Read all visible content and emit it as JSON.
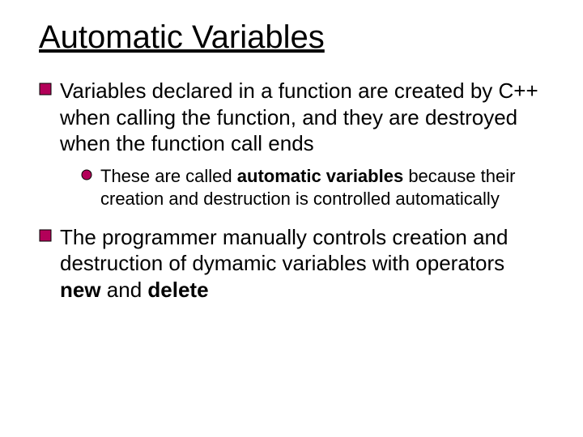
{
  "title": "Automatic Variables",
  "bullets": {
    "b1": {
      "pre": "Variables declared in a function are created by C++ when calling the function, and they are destroyed when the function call ends"
    },
    "b1a": {
      "pre": "These are called ",
      "bold": "automatic variables",
      "post": " because their creation and destruction is controlled automatically"
    },
    "b2": {
      "pre": "The programmer manually controls creation and destruction of dymamic variables with operators ",
      "bold1": "new",
      "mid": " and ",
      "bold2": "delete"
    }
  }
}
